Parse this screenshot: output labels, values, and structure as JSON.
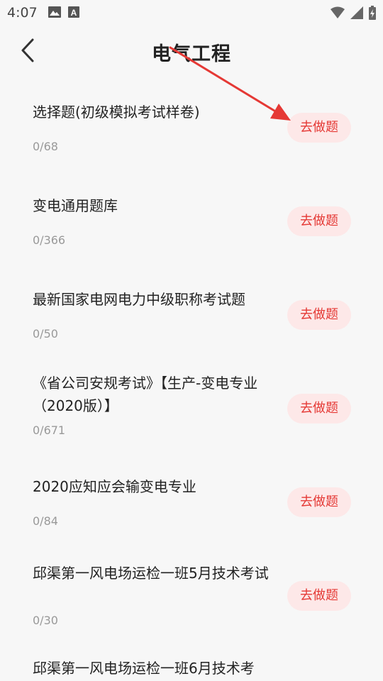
{
  "status_bar": {
    "time": "4:07"
  },
  "header": {
    "title": "电气工程"
  },
  "colors": {
    "accent": "#e53935",
    "button_bg": "#fde8e8",
    "background": "#f7f7f7",
    "annotation_arrow": "#e53935"
  },
  "icons": {
    "back": "chevron-left-icon",
    "status_image": "image-icon",
    "status_font": "font-icon",
    "status_wifi": "wifi-icon",
    "status_signal": "signal-icon",
    "status_battery": "battery-icon"
  },
  "items": [
    {
      "title": "选择题(初级模拟考试样卷)",
      "progress": "0/68",
      "button": "去做题"
    },
    {
      "title": "变电通用题库",
      "progress": "0/366",
      "button": "去做题"
    },
    {
      "title": "最新国家电网电力中级职称考试题",
      "progress": "0/50",
      "button": "去做题"
    },
    {
      "title": "《省公司安规考试》【生产-变电专业（2020版）】",
      "progress": "0/671",
      "button": "去做题"
    },
    {
      "title": "2020应知应会输变电专业",
      "progress": "0/84",
      "button": "去做题"
    },
    {
      "title": "邱渠第一风电场运检一班5月技术考试",
      "progress": "0/30",
      "button": "去做题"
    },
    {
      "title": "邱渠第一风电场运检一班6月技术考"
    }
  ]
}
